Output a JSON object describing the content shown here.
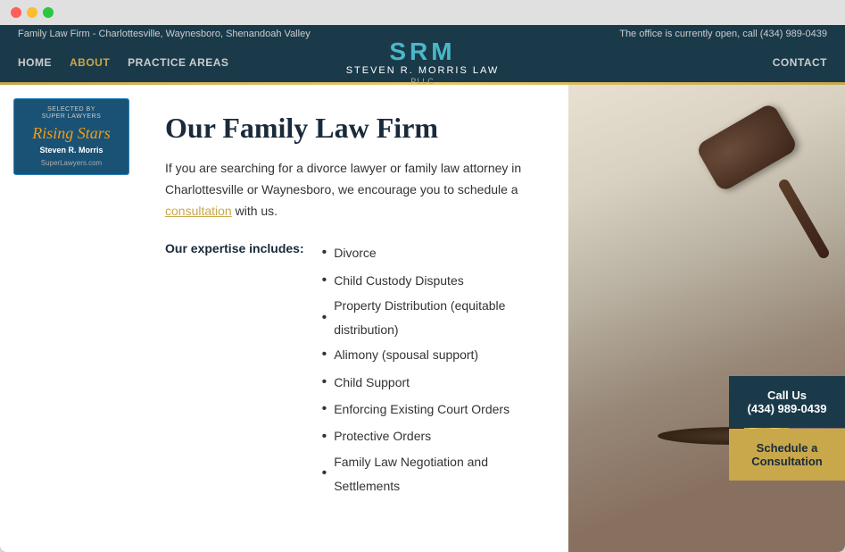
{
  "browser": {
    "btn_close": "close",
    "btn_min": "minimize",
    "btn_max": "maximize"
  },
  "top_bar": {
    "firm_info": "Family Law Firm - Charlottesville, Waynesboro, Shenandoah Valley",
    "office_status": "The office is currently open, call ",
    "phone": "(434) 989-0439"
  },
  "nav": {
    "items": [
      {
        "label": "HOME",
        "active": false
      },
      {
        "label": "ABOUT",
        "active": true
      },
      {
        "label": "PRACTICE AREAS",
        "active": false
      }
    ],
    "logo_letters": "SRM",
    "logo_name": "STEVEN R. MORRIS LAW",
    "logo_pllc": "PLLC",
    "contact_label": "CONTACT"
  },
  "badge": {
    "header_line1": "Selected by",
    "header_line2": "Super Lawyers",
    "stars_text": "Rising Stars",
    "name": "Steven R. Morris",
    "site": "SuperLawyers.com"
  },
  "main": {
    "heading": "Our Family Law Firm",
    "intro_part1": "If you are searching for a divorce lawyer or family law attorney in Charlottesville or Waynesboro, we encourage you to schedule a ",
    "consultation_link": "consultation",
    "intro_part2": " with us.",
    "expertise_label": "Our expertise includes:",
    "expertise_items": [
      "Divorce",
      "Child Custody Disputes",
      "Property Distribution (equitable distribution)",
      "Alimony (spousal support)",
      "Child Support",
      "Enforcing Existing Court Orders",
      "Protective Orders",
      "Family Law Negotiation and Settlements"
    ]
  },
  "cta": {
    "call_line1": "Call Us",
    "call_phone": "(434) 989-0439",
    "schedule_label": "Schedule a Consultation"
  }
}
